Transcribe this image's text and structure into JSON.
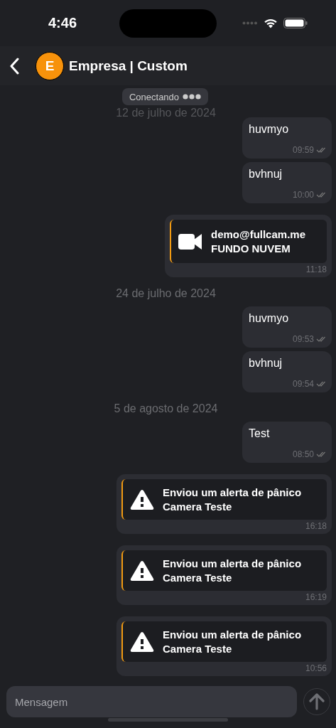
{
  "status_bar": {
    "time": "4:46"
  },
  "header": {
    "avatar_letter": "E",
    "title": "Empresa | Custom"
  },
  "connection_pill": {
    "label": "Conectando"
  },
  "messages": [
    {
      "kind": "date",
      "text": "12 de julho de 2024"
    },
    {
      "kind": "text",
      "text": "huvmyo",
      "time": "09:59"
    },
    {
      "kind": "text",
      "text": "bvhnuj",
      "time": "10:00"
    },
    {
      "kind": "video",
      "line1": "demo@fullcam.me",
      "line2": "FUNDO NUVEM",
      "time": "11:18"
    },
    {
      "kind": "date",
      "text": "24 de julho de 2024"
    },
    {
      "kind": "text",
      "text": "huvmyo",
      "time": "09:53"
    },
    {
      "kind": "text",
      "text": "bvhnuj",
      "time": "09:54"
    },
    {
      "kind": "date",
      "text": "5 de agosto de 2024"
    },
    {
      "kind": "text",
      "text": "Test",
      "time": "08:50"
    },
    {
      "kind": "alert",
      "line1": "Enviou um alerta de pânico",
      "line2": "Camera Teste",
      "time": "16:18"
    },
    {
      "kind": "alert",
      "line1": "Enviou um alerta de pânico",
      "line2": "Camera Teste",
      "time": "16:19"
    },
    {
      "kind": "alert",
      "line1": "Enviou um alerta de pânico",
      "line2": "Camera Teste",
      "time": "10:56"
    }
  ],
  "composer": {
    "placeholder": "Mensagem"
  }
}
